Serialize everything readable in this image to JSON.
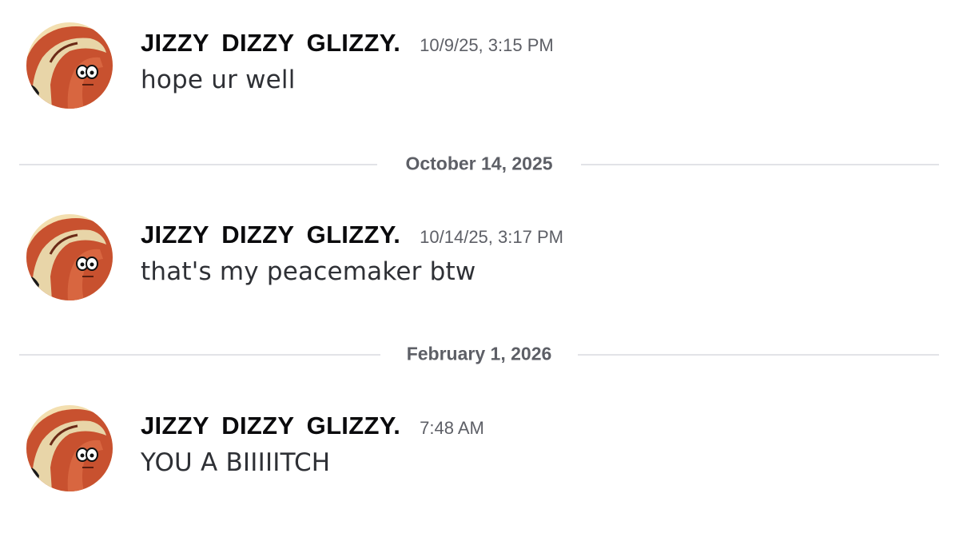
{
  "messages": [
    {
      "author": "JIZZY  DIZZY  GLIZZY.",
      "timestamp": "10/9/25, 3:15 PM",
      "content": "hope ur well",
      "avatar_icon": "patrick-star-avatar"
    },
    {
      "author": "JIZZY  DIZZY  GLIZZY.",
      "timestamp": "10/14/25, 3:17 PM",
      "content": "that's my peacemaker btw",
      "avatar_icon": "patrick-star-avatar"
    },
    {
      "author": "JIZZY  DIZZY  GLIZZY.",
      "timestamp": "7:48 AM",
      "content": "YOU A BIIIIITCH",
      "avatar_icon": "patrick-star-avatar"
    }
  ],
  "dividers": [
    {
      "date": "October 14, 2025"
    },
    {
      "date": "February 1, 2026"
    }
  ],
  "colors": {
    "background": "#ffffff",
    "username": "#0a0a0c",
    "timestamp": "#5d5f66",
    "content": "#2e3035",
    "divider_line": "#e2e3e7",
    "avatar_skin": "#c8512f",
    "avatar_bg": "#f3dfb0"
  }
}
